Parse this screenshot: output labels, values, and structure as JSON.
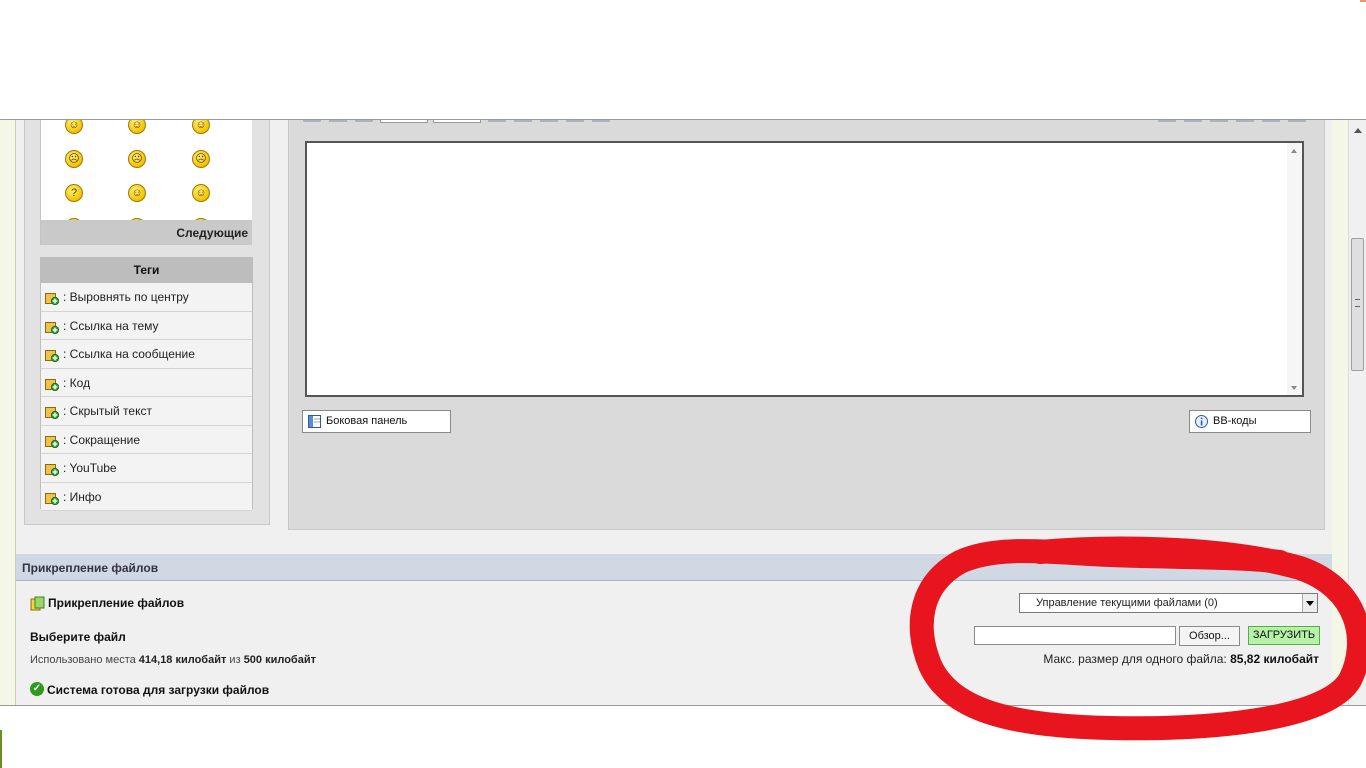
{
  "smileys": {
    "rows": [
      [
        "☺",
        "☺",
        "☺"
      ],
      [
        "☹",
        "☹",
        "☹"
      ],
      [
        "?",
        "☺",
        "☺"
      ],
      [
        "!",
        "☺",
        "!"
      ]
    ],
    "next_label": "Следующие"
  },
  "tags": {
    "title": "Теги",
    "items": [
      {
        "label": ": Выровнять по центру"
      },
      {
        "label": ": Ссылка на тему"
      },
      {
        "label": ": Ссылка на сообщение"
      },
      {
        "label": ": Код"
      },
      {
        "label": ": Скрытый текст"
      },
      {
        "label": ": Сокращение"
      },
      {
        "label": ": YouTube"
      },
      {
        "label": ": Инфо"
      }
    ]
  },
  "editor": {
    "message_value": "",
    "sidebar_button": "Боковая панель",
    "bbcodes_button": "BB-коды"
  },
  "attachments": {
    "section_title": "Прикрепление файлов",
    "title": "Прикрепление файлов",
    "choose_label": "Выберите файл",
    "used_prefix": "Использовано места ",
    "used_value": "414,18 килобайт",
    "used_of": " из ",
    "used_limit": "500 килобайт",
    "ready_text": "Система готова для загрузки файлов",
    "manage_select": "Управление текущими файлами (0)",
    "file_input_value": "",
    "browse_button": "Обзор...",
    "upload_button": "ЗАГРУЗИТЬ",
    "max_size_prefix": "Макс. размер для одного файла: ",
    "max_size_value": "85,82 килобайт"
  },
  "colors": {
    "annotation": "#e8141e",
    "upload_button_bg": "#b6f2a8",
    "section_header_bg": "#cfd8e3"
  }
}
